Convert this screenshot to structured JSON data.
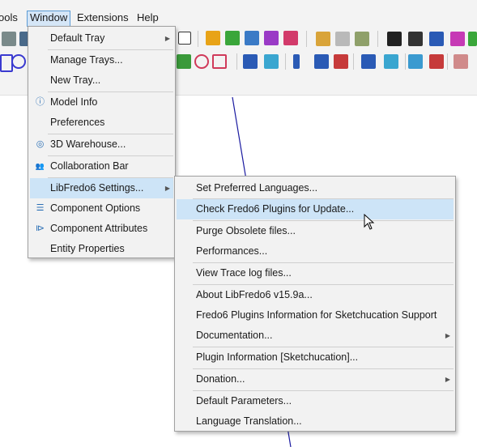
{
  "menubar": {
    "items": [
      {
        "label": "ools"
      },
      {
        "label": "Window"
      },
      {
        "label": "Extensions"
      },
      {
        "label": "Help"
      }
    ]
  },
  "window_menu": {
    "items": [
      {
        "label": "Default Tray",
        "icon": "",
        "has_submenu": true
      },
      {
        "label": "Manage Trays...",
        "icon": ""
      },
      {
        "label": "New Tray...",
        "icon": ""
      },
      {
        "label": "Model Info",
        "icon": "info-icon"
      },
      {
        "label": "Preferences",
        "icon": ""
      },
      {
        "label": "3D Warehouse...",
        "icon": "warehouse-icon"
      },
      {
        "label": "Collaboration Bar",
        "icon": "users-icon"
      },
      {
        "label": "LibFredo6 Settings...",
        "icon": "",
        "has_submenu": true
      },
      {
        "label": "Component Options",
        "icon": "component-options-icon"
      },
      {
        "label": "Component Attributes",
        "icon": "component-attributes-icon"
      },
      {
        "label": "Entity Properties",
        "icon": ""
      }
    ]
  },
  "libfredo_menu": {
    "items": [
      {
        "label": "Set Preferred Languages..."
      },
      {
        "label": "Check Fredo6 Plugins for Update..."
      },
      {
        "label": "Purge Obsolete files..."
      },
      {
        "label": "Performances..."
      },
      {
        "label": "View Trace log files..."
      },
      {
        "label": "About LibFredo6 v15.9a..."
      },
      {
        "label": "Fredo6 Plugins Information for Sketchucation Support"
      },
      {
        "label": "Documentation...",
        "has_submenu": true
      },
      {
        "label": "Plugin Information [Sketchucation]..."
      },
      {
        "label": "Donation...",
        "has_submenu": true
      },
      {
        "label": "Default Parameters..."
      },
      {
        "label": "Language Translation..."
      }
    ]
  },
  "glyphs": {
    "submenu_arrow": "▶",
    "info": "ⓘ",
    "warehouse": "◎",
    "users": "👥",
    "component_options": "☰",
    "component_attributes": "⧐"
  },
  "colors": {
    "menu_bg": "#f2f2f2",
    "hover_bg": "#cde4f7",
    "active_menubar_bg": "#d5e6f7",
    "canvas_line": "#1a1aa0"
  }
}
